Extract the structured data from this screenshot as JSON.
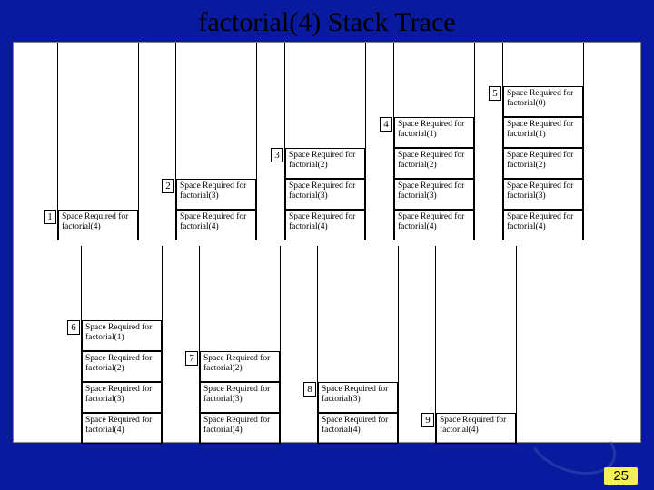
{
  "title": "factorial(4) Stack Trace",
  "page_number": "25",
  "cell_text": {
    "f4": "Space Required for factorial(4)",
    "f3": "Space Required for factorial(3)",
    "f2": "Space Required for factorial(2)",
    "f1": "Space Required for factorial(1)",
    "f0": "Space Required for factorial(0)"
  },
  "steps": {
    "s1": "1",
    "s2": "2",
    "s3": "3",
    "s4": "4",
    "s5": "5",
    "s6": "6",
    "s7": "7",
    "s8": "8",
    "s9": "9"
  },
  "chart_data": {
    "type": "diagram",
    "description": "Call stack growth and shrink for recursive factorial(4)",
    "top_row_columns": [
      {
        "step": 1,
        "frames": [
          "factorial(4)"
        ]
      },
      {
        "step": 2,
        "frames": [
          "factorial(3)",
          "factorial(4)"
        ]
      },
      {
        "step": 3,
        "frames": [
          "factorial(2)",
          "factorial(3)",
          "factorial(4)"
        ]
      },
      {
        "step": 4,
        "frames": [
          "factorial(1)",
          "factorial(2)",
          "factorial(3)",
          "factorial(4)"
        ]
      },
      {
        "step": 5,
        "frames": [
          "factorial(0)",
          "factorial(1)",
          "factorial(2)",
          "factorial(3)",
          "factorial(4)"
        ]
      }
    ],
    "bottom_row_columns": [
      {
        "step": 6,
        "frames": [
          "factorial(1)",
          "factorial(2)",
          "factorial(3)",
          "factorial(4)"
        ]
      },
      {
        "step": 7,
        "frames": [
          "factorial(2)",
          "factorial(3)",
          "factorial(4)"
        ]
      },
      {
        "step": 8,
        "frames": [
          "factorial(3)",
          "factorial(4)"
        ]
      },
      {
        "step": 9,
        "frames": [
          "factorial(4)"
        ]
      }
    ]
  }
}
